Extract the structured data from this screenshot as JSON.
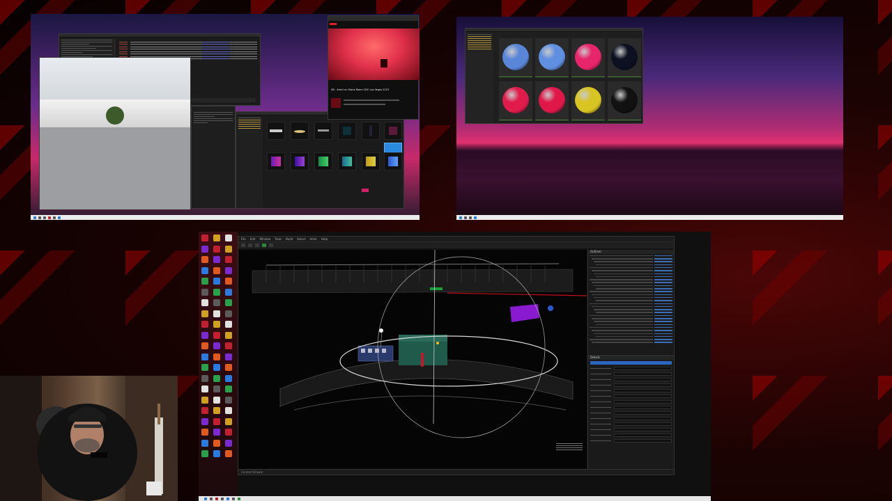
{
  "top_left_monitor": {
    "browser_tab": {
      "video_title": "VB - Amici on Stone Room CDC Las Vegas 2023"
    }
  },
  "top_right_monitor": {
    "spheres": [
      {
        "color": "#5a86d8"
      },
      {
        "color": "#5f8fe0"
      },
      {
        "color": "#e8246a"
      },
      {
        "color": "#0c1020"
      },
      {
        "color": "#e01c4c"
      },
      {
        "color": "#e0184a"
      },
      {
        "color": "#d8c422"
      },
      {
        "color": "#111111"
      }
    ]
  },
  "main_editor": {
    "menu": [
      "File",
      "Edit",
      "Window",
      "Tools",
      "Build",
      "Select",
      "Actor",
      "Help"
    ],
    "outliner_title": "Outliner",
    "details_title": "Details",
    "status_text": "Content Drawer"
  },
  "colors": {
    "accent_red": "#c0101a",
    "brand_blue": "#3d6fb8"
  },
  "icons": [
    "desktop-shortcut-icon",
    "taskbar-app-icon",
    "windows-start-icon"
  ]
}
